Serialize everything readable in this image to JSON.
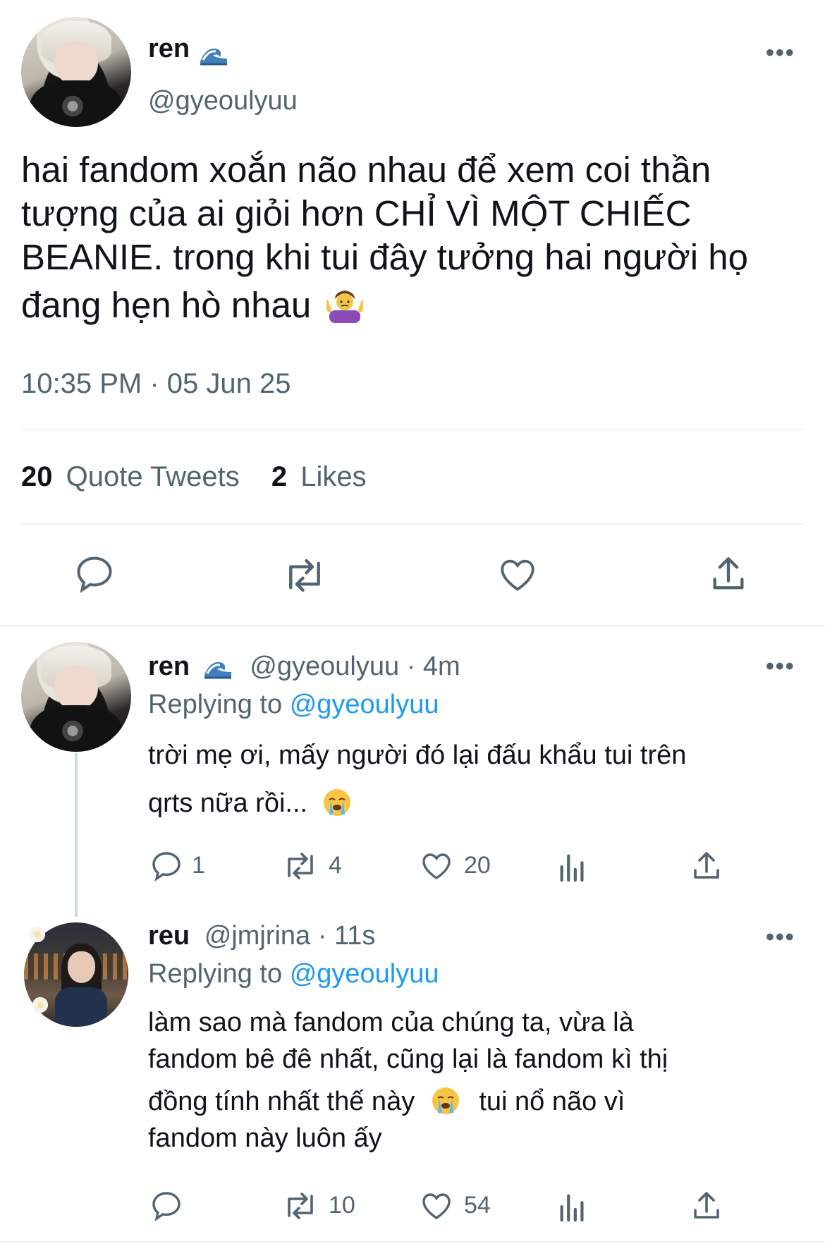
{
  "main_tweet": {
    "name": "ren",
    "handle": "@gyeoulyuu",
    "text_lines": [
      "hai fandom xoắn não nhau để xem coi thần",
      "tượng của ai giỏi hơn CHỈ VÌ MỘT CHIẾC",
      "BEANIE. trong khi tui đây tưởng hai người họ",
      "đang hẹn hò nhau"
    ],
    "timestamp": "10:35 PM · 05 Jun 25",
    "stats": {
      "quote_count": "20",
      "quote_label": "Quote Tweets",
      "like_count": "2",
      "like_label": "Likes"
    },
    "more_icon": "ellipsis-icon",
    "actions": [
      "reply-icon",
      "retweet-icon",
      "like-icon",
      "share-icon"
    ]
  },
  "replies": [
    {
      "name": "ren",
      "handle": "@gyeoulyuu",
      "time": "· 4m",
      "replying_label": "Replying to",
      "replying_handle": "@gyeoulyuu",
      "text_lines": [
        "trời mẹ ơi, mấy người đó lại đấu khẩu tui trên",
        "qrts nữa rồi..."
      ],
      "reply_count": "1",
      "retweet_count": "4",
      "like_count": "20"
    },
    {
      "name": "reu",
      "handle": "@jmjrina",
      "time": "· 11s",
      "replying_label": "Replying to",
      "replying_handle": "@gyeoulyuu",
      "text_lines": [
        "làm sao mà fandom của chúng ta, vừa là",
        "fandom bê đê nhất, cũng lại là fandom kì thị",
        "đồng tính nhất thế này",
        "tui nổ não vì",
        "fandom này luôn ấy"
      ],
      "reply_count": "",
      "retweet_count": "10",
      "like_count": "54"
    }
  ],
  "colors": {
    "text": "#0f1419",
    "muted": "#536471",
    "link": "#1d9bf0",
    "divider": "#eff3f4"
  }
}
